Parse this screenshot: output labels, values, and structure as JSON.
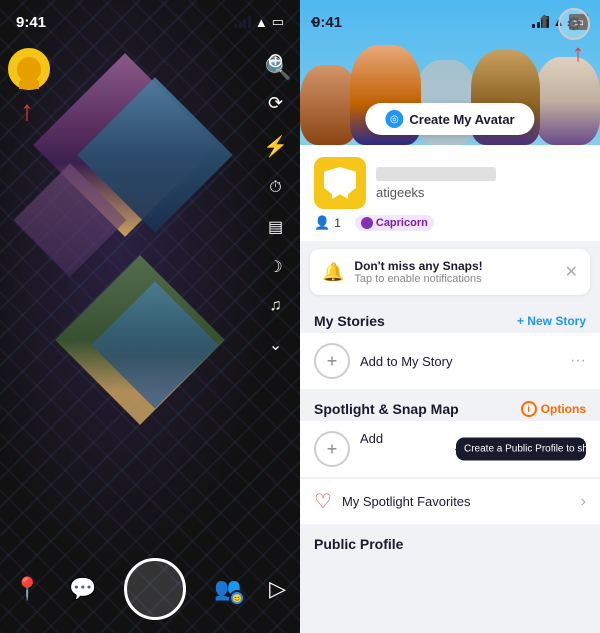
{
  "left": {
    "status_time": "9:41",
    "controls": {
      "search_label": "🔍",
      "add_friend_label": "⊕",
      "flip_camera_label": "⟳",
      "flash_label": "⚡",
      "timer_label": "⏱",
      "filmstrip_label": "▤",
      "night_label": "☽",
      "music_label": "♫",
      "more_label": "⌄"
    },
    "bottom": {
      "location_label": "📍",
      "chat_label": "💬",
      "camera_label": "◎",
      "friends_label": "👥",
      "spotlight_label": "▷"
    }
  },
  "right": {
    "status_time": "9:41",
    "header": {
      "back_label": "‹",
      "upload_label": "⬆",
      "settings_label": "⚙"
    },
    "create_avatar_btn": "Create My Avatar",
    "profile": {
      "username": "atigeeks",
      "friend_count": "1",
      "zodiac": "Capricorn"
    },
    "notification": {
      "title": "Don't miss any Snaps!",
      "subtitle": "Tap to enable notifications"
    },
    "my_stories": {
      "section_title": "My Stories",
      "new_story_label": "+ New Story",
      "add_to_story_label": "Add to My Story"
    },
    "spotlight": {
      "section_title": "Spotlight & Snap Map",
      "options_label": "Options",
      "add_label": "Add",
      "tooltip_text": "Create a Public Profile to show your name"
    },
    "favorites": {
      "label": "My Spotlight Favorites"
    },
    "public_profile": {
      "title": "Public Profile"
    }
  }
}
